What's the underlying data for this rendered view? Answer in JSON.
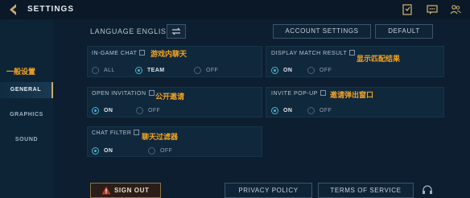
{
  "header": {
    "title": "SETTINGS"
  },
  "sidebar": {
    "annotation": "一般设置",
    "items": [
      {
        "label": "GENERAL"
      },
      {
        "label": "GRAPHICS"
      },
      {
        "label": "SOUND"
      }
    ]
  },
  "language": {
    "label": "LANGUAGE ENGLISH"
  },
  "header_buttons": {
    "account": "ACCOUNT SETTINGS",
    "default": "DEFAULT"
  },
  "in_game_chat": {
    "label": "IN-GAME CHAT",
    "annotation": "游戏内聊天",
    "options": [
      "ALL",
      "TEAM",
      "OFF"
    ],
    "selected": "TEAM"
  },
  "display_match_result": {
    "label": "DISPLAY MATCH RESULT",
    "annotation": "显示匹配结果",
    "options": [
      "ON",
      "OFF"
    ],
    "selected": "ON"
  },
  "open_invitation": {
    "label": "OPEN INVITATION",
    "annotation": "公开邀请",
    "options": [
      "ON",
      "OFF"
    ],
    "selected": "ON"
  },
  "invite_popup": {
    "label": "INVITE POP-UP",
    "annotation": "邀请弹出窗口",
    "options": [
      "ON",
      "OFF"
    ],
    "selected": "ON"
  },
  "chat_filter": {
    "label": "CHAT FILTER",
    "annotation": "聊天过滤器",
    "options": [
      "ON",
      "OFF"
    ],
    "selected": "ON"
  },
  "footer": {
    "sign_out": "SIGN OUT",
    "privacy": "PRIVACY POLICY",
    "terms": "TERMS OF SERVICE"
  },
  "colors": {
    "annotation": "#f5a524",
    "radio_on": "#4fb5d6",
    "gold_accent": "#c8aa6e",
    "background": "#0c1e2f"
  },
  "icons": [
    "back-chevron-icon",
    "quest-book-icon",
    "chat-icon",
    "friends-icon",
    "swap-icon",
    "info-icon",
    "warning-icon",
    "headset-icon"
  ]
}
